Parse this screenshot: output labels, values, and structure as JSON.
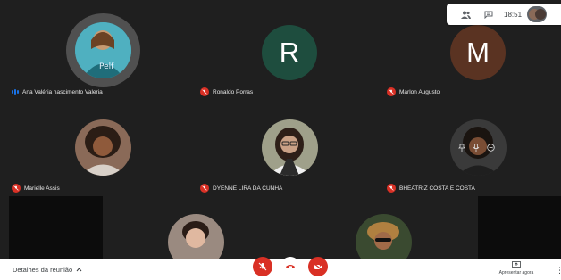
{
  "clock": "18:51",
  "participants": [
    {
      "name": "Ana Valéria nascimento Valeria",
      "speaking": true
    },
    {
      "name": "Ronaldo Porras",
      "initial": "R",
      "color": "#1e4d3e",
      "muted": true
    },
    {
      "name": "Marlon Augusto",
      "initial": "M",
      "color": "#5a3322",
      "muted": true
    },
    {
      "name": "Marielle Assis",
      "muted": true
    },
    {
      "name": "DYENNE LIRA DA CUNHA",
      "muted": true
    },
    {
      "name": "BHEATRIZ COSTA E COSTA",
      "muted": true
    }
  ],
  "footer": {
    "meeting_details": "Detalhes da reunião",
    "present_now": "Apresentar agora"
  },
  "colors": {
    "stage": "#1f1f1f",
    "mic_off_red": "#d93025",
    "speaking_blue": "#1a73e8"
  }
}
